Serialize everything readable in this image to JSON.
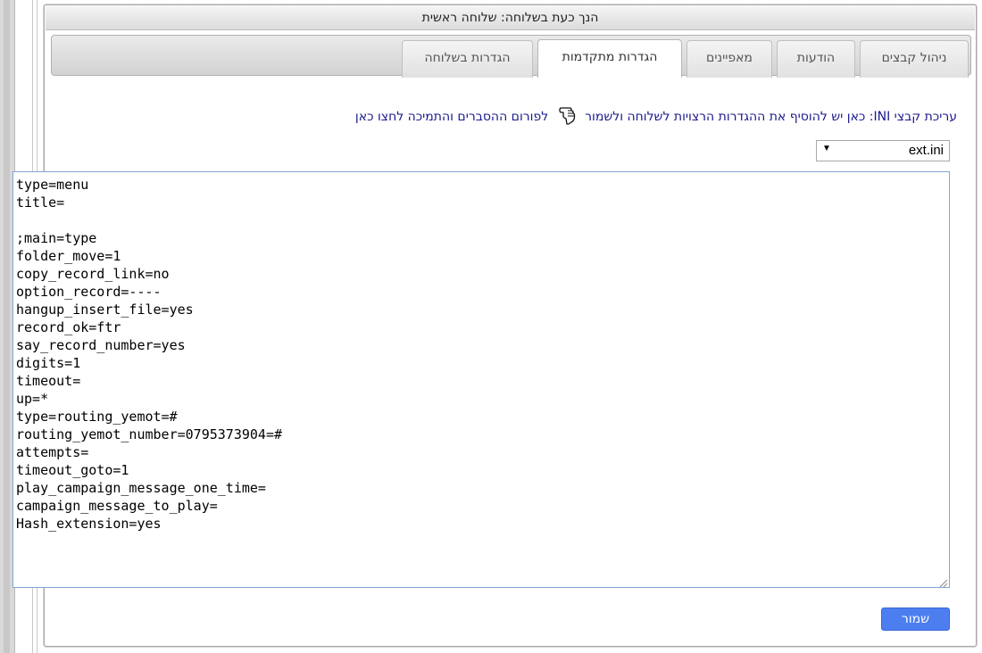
{
  "panel": {
    "header_title": "הנך כעת בשלוחה: שלוחה ראשית"
  },
  "tabs": [
    {
      "label": "ניהול קבצים",
      "active": false
    },
    {
      "label": "הודעות",
      "active": false
    },
    {
      "label": "מאפיינים",
      "active": false
    },
    {
      "label": "הגדרות מתקדמות",
      "active": true
    },
    {
      "label": "הגדרות בשלוחה",
      "active": false
    }
  ],
  "intro": {
    "text": "עריכת קבצי INI: כאן יש להוסיף את ההגדרות הרצויות לשלוחה ולשמור",
    "link_text": "לפורום ההסברים והתמיכה לחצו כאן",
    "icon": "pointing-hand-icon"
  },
  "file_select": {
    "selected": "ext.ini"
  },
  "editor": {
    "content": "type=menu\ntitle=\n\n;main=type\nfolder_move=1\ncopy_record_link=no\noption_record=----\nhangup_insert_file=yes\nrecord_ok=ftr\nsay_record_number=yes\ndigits=1\ntimeout=\nup=*\ntype=routing_yemot=#\nrouting_yemot_number=0795373904=#\nattempts=\ntimeout_goto=1\nplay_campaign_message_one_time=\ncampaign_message_to_play=\nHash_extension=yes"
  },
  "actions": {
    "save_label": "שמור"
  },
  "colors": {
    "link": "#1a1a8c",
    "save_button": "#4d7ef0",
    "editor_border": "#7fa6d6"
  }
}
